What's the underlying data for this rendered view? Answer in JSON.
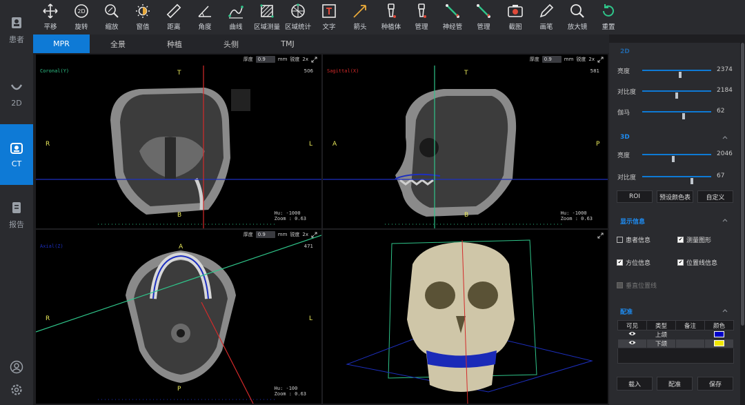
{
  "sidebar": {
    "items": [
      {
        "label": "患者",
        "icon": "patient-icon"
      },
      {
        "label": "2D",
        "icon": "dental-arch-icon"
      },
      {
        "label": "CT",
        "icon": "ct-icon",
        "active": true
      },
      {
        "label": "报告",
        "icon": "report-icon"
      }
    ],
    "bottom": [
      {
        "icon": "user-icon"
      },
      {
        "icon": "gear-icon"
      }
    ]
  },
  "toolbar": {
    "tools": [
      {
        "label": "平移",
        "icon": "pan-icon"
      },
      {
        "label": "旋转",
        "icon": "rotate-2d-icon"
      },
      {
        "label": "缩放",
        "icon": "zoom-icon"
      },
      {
        "label": "窗值",
        "icon": "window-level-icon"
      },
      {
        "label": "距离",
        "icon": "ruler-icon"
      },
      {
        "label": "角度",
        "icon": "angle-icon"
      },
      {
        "label": "曲线",
        "icon": "curve-icon"
      },
      {
        "label": "区域测量",
        "icon": "area-measure-icon"
      },
      {
        "label": "区域统计",
        "icon": "area-stats-icon"
      },
      {
        "label": "文字",
        "icon": "text-icon"
      },
      {
        "label": "箭头",
        "icon": "arrow-icon"
      },
      {
        "label": "种植体",
        "icon": "implant-icon"
      },
      {
        "label": "管理",
        "icon": "implant-manage-icon"
      },
      {
        "label": "神经管",
        "icon": "nerve-canal-icon"
      },
      {
        "label": "管理",
        "icon": "nerve-manage-icon"
      },
      {
        "label": "截图",
        "icon": "screenshot-icon"
      },
      {
        "label": "画笔",
        "icon": "pen-icon"
      },
      {
        "label": "放大镜",
        "icon": "magnifier-icon"
      },
      {
        "label": "重置",
        "icon": "reset-icon"
      }
    ]
  },
  "tabs": [
    {
      "label": "MPR",
      "active": true
    },
    {
      "label": "全景"
    },
    {
      "label": "种植"
    },
    {
      "label": "头侧"
    },
    {
      "label": "TMJ"
    }
  ],
  "viewports": {
    "coronal": {
      "title": "Coronal(Y)",
      "thickness_label": "厚度",
      "thickness": "0.9",
      "unit": "mm",
      "sharp_label": "锐度",
      "sharp": "2x",
      "slice": "506",
      "top": "T",
      "left": "R",
      "right": "L",
      "bottom": "B",
      "hu": "Hu: -1000",
      "zoom": "Zoom : 0.63"
    },
    "sagittal": {
      "title": "Sagittal(X)",
      "thickness_label": "厚度",
      "thickness": "0.9",
      "unit": "mm",
      "sharp_label": "锐度",
      "sharp": "2x",
      "slice": "581",
      "top": "T",
      "left": "A",
      "right": "P",
      "bottom": "B",
      "hu": "Hu: -1000",
      "zoom": "Zoom : 0.63"
    },
    "axial": {
      "title": "Axial(Z)",
      "thickness_label": "厚度",
      "thickness": "0.9",
      "unit": "mm",
      "sharp_label": "锐度",
      "sharp": "2x",
      "slice": "471",
      "top": "A",
      "left": "R",
      "right": "L",
      "bottom": "P",
      "hu": "Hu: -100",
      "zoom": "Zoom : 0.63"
    }
  },
  "panel": {
    "section2d": "2D",
    "sliders2d": [
      {
        "label": "亮度",
        "value": "2374",
        "pos": 0.55
      },
      {
        "label": "对比度",
        "value": "2184",
        "pos": 0.5
      },
      {
        "label": "伽马",
        "value": "62",
        "pos": 0.6
      }
    ],
    "section3d": "3D",
    "sliders3d": [
      {
        "label": "亮度",
        "value": "2046",
        "pos": 0.45
      },
      {
        "label": "对比度",
        "value": "67",
        "pos": 0.72
      }
    ],
    "buttons": [
      "ROI",
      "预设颜色表",
      "自定义"
    ],
    "display_title": "显示信息",
    "display": [
      {
        "label": "患者信息",
        "checked": false
      },
      {
        "label": "测量图形",
        "checked": true
      },
      {
        "label": "方位信息",
        "checked": true
      },
      {
        "label": "位置线信息",
        "checked": true
      },
      {
        "label": "垂直位置线",
        "checked": false,
        "disabled": true
      }
    ],
    "registration_title": "配准",
    "table": {
      "headers": [
        "可见",
        "类型",
        "备注",
        "颜色"
      ],
      "rows": [
        {
          "type": "上颌",
          "note": "",
          "color": "#0000c8"
        },
        {
          "type": "下颌",
          "note": "",
          "color": "#f0e600"
        }
      ]
    },
    "bottom_buttons": [
      "载入",
      "配准",
      "保存"
    ]
  }
}
